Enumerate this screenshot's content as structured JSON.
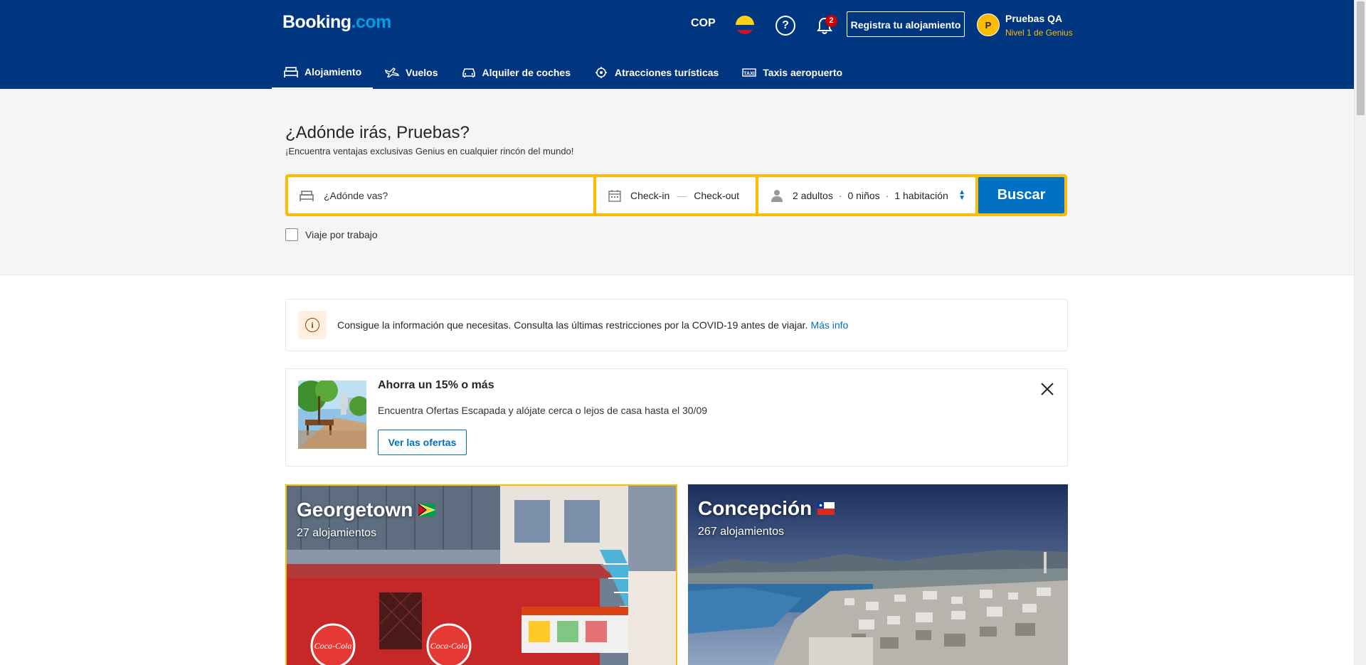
{
  "header": {
    "logo_main": "Booking",
    "logo_dot": ".com",
    "currency": "COP",
    "help_symbol": "?",
    "notifications_count": "2",
    "register_label": "Registra tu alojamiento",
    "user": {
      "initial": "P",
      "name": "Pruebas QA",
      "level": "Nivel 1 de Genius"
    }
  },
  "nav": [
    {
      "label": "Alojamiento",
      "icon": "bed-icon",
      "active": true
    },
    {
      "label": "Vuelos",
      "icon": "plane-icon",
      "active": false
    },
    {
      "label": "Alquiler de coches",
      "icon": "car-icon",
      "active": false
    },
    {
      "label": "Atracciones turísticas",
      "icon": "attractions-icon",
      "active": false
    },
    {
      "label": "Taxis aeropuerto",
      "icon": "taxi-icon",
      "active": false
    }
  ],
  "hero": {
    "title": "¿Adónde irás, Pruebas?",
    "subtitle": "¡Encuentra ventajas exclusivas Genius en cualquier rincón del mundo!"
  },
  "search": {
    "destination_placeholder": "¿Adónde vas?",
    "checkin": "Check-in",
    "dash": "—",
    "checkout": "Check-out",
    "adults": "2 adultos",
    "children": "0 niños",
    "rooms": "1 habitación",
    "separator": "·",
    "submit": "Buscar",
    "work_trip": "Viaje por trabajo"
  },
  "covid_notice": {
    "icon_symbol": "i",
    "message": "Consigue la información que necesitas. Consulta las últimas restricciones por la COVID-19 antes de viajar.",
    "link": "Más info"
  },
  "promo": {
    "title": "Ahorra un 15% o más",
    "description": "Encuentra Ofertas Escapada y alójate cerca o lejos de casa hasta el 30/09",
    "button": "Ver las ofertas"
  },
  "destinations": [
    {
      "name": "Georgetown",
      "count": "27 alojamientos",
      "flag": "guyana-flag-icon"
    },
    {
      "name": "Concepción",
      "count": "267 alojamientos",
      "flag": "chile-flag-icon"
    }
  ],
  "colors": {
    "brand_blue": "#003580",
    "accent_yellow": "#febb02",
    "action_blue": "#0071c2",
    "badge_red": "#cc0000"
  }
}
